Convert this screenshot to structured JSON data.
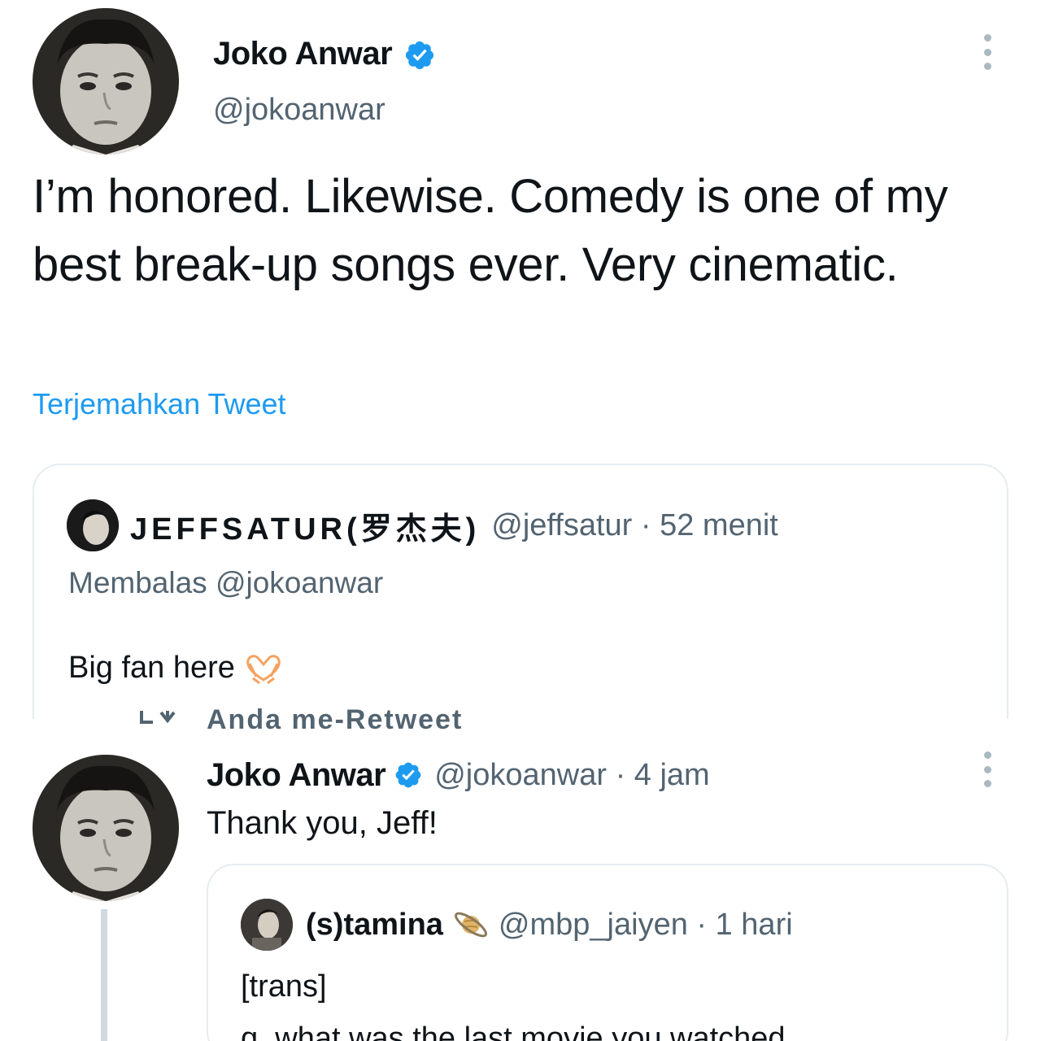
{
  "header_tweet": {
    "author_name": "Joko Anwar",
    "handle": "@jokoanwar",
    "text": "I’m honored. Likewise. Comedy is one of my best break-up songs ever. Very cinematic.",
    "translate_link": "Terjemahkan Tweet"
  },
  "quoted_tweet": {
    "author_name": "JEFFSATUR(罗杰夫)",
    "meta": "@jeffsatur · 52 menit",
    "reply_to": "Membalas @jokoanwar",
    "text": "Big fan here"
  },
  "retweet_label": "Anda me-Retweet",
  "reply_tweet": {
    "author_name": "Joko Anwar",
    "meta": "@jokoanwar · 4 jam",
    "text": "Thank you, Jeff!"
  },
  "nested_quote": {
    "author_name": "(s)tamina",
    "meta": "@mbp_jaiyen · 1 hari",
    "line1": "[trans]",
    "line2": "q. what was the last movie you watched"
  },
  "colors": {
    "link": "#1d9bf0",
    "secondary_text": "#536471",
    "verified_badge": "#1d9bf0",
    "border": "#e6ecf0"
  },
  "icons": [
    "verified-badge-icon",
    "more-options-icon",
    "heart-hands-emoji",
    "retweet-icon",
    "saturn-emoji"
  ]
}
